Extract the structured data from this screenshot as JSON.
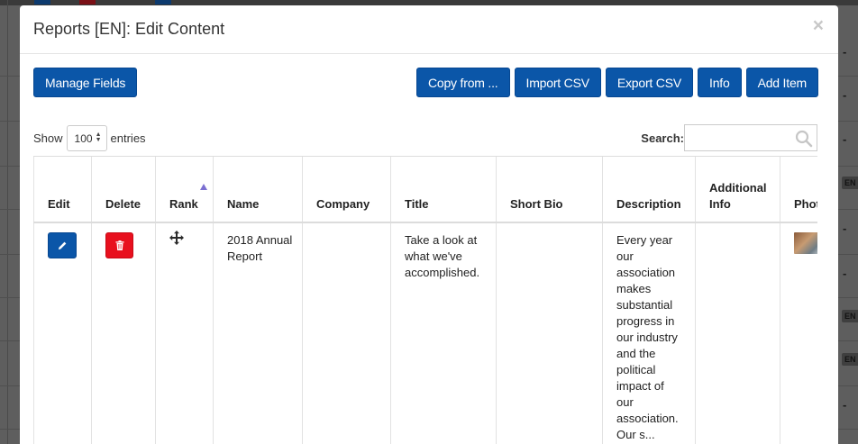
{
  "modal": {
    "title": "Reports [EN]: Edit Content",
    "close_symbol": "×"
  },
  "toolbar": {
    "manage_fields": "Manage Fields",
    "copy_from": "Copy from ...",
    "import_csv": "Import CSV",
    "export_csv": "Export CSV",
    "info": "Info",
    "add_item": "Add Item"
  },
  "entries": {
    "show_label": "Show",
    "selected": "100",
    "entries_label": "entries"
  },
  "search": {
    "label": "Search:",
    "value": "",
    "placeholder": ""
  },
  "table": {
    "columns": [
      "Edit",
      "Delete",
      "Rank",
      "Name",
      "Company",
      "Title",
      "Short Bio",
      "Description",
      "Additional Info",
      "Photo"
    ],
    "sorted_column": "Rank",
    "rows": [
      {
        "name": "2018 Annual Report",
        "company": "",
        "title": "Take a look at what we've accomplished.",
        "short_bio": "",
        "description": "Every year our association makes substantial progress in our industry and the political impact of our association. Our s...",
        "additional_info": ""
      }
    ]
  },
  "background": {
    "dash": "-",
    "badge": "EN"
  },
  "colors": {
    "primary": "#0b56a8",
    "danger": "#e8101e",
    "sort_arrow": "#7b6fd1"
  },
  "icons": {
    "edit": "pencil-icon",
    "delete": "trash-icon",
    "rank": "move-icon",
    "search": "magnifier-icon",
    "close": "close-icon"
  }
}
